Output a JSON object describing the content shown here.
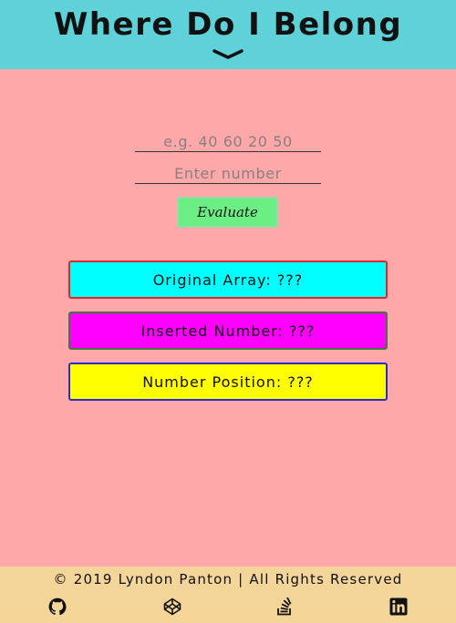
{
  "header": {
    "title": "Where Do I Belong",
    "toggle_icon": "chevron-down-icon"
  },
  "form": {
    "array_placeholder": "e.g. 40 60 20 50",
    "array_value": "",
    "number_placeholder": "Enter number",
    "number_value": "",
    "evaluate_label": "Evaluate",
    "evaluate_color": "#6bef84"
  },
  "results": {
    "original_array": "Original Array: ???",
    "inserted_number": "Inserted Number: ???",
    "number_position": "Number Position: ???"
  },
  "footer": {
    "copyright": "© 2019 Lyndon Panton | All Rights Reserved",
    "links": [
      {
        "icon": "github-icon"
      },
      {
        "icon": "codepen-icon"
      },
      {
        "icon": "stackoverflow-icon"
      },
      {
        "icon": "linkedin-icon"
      }
    ]
  },
  "colors": {
    "header_bg": "#5fd2d9",
    "page_bg": "#ffa8aa",
    "footer_bg": "#f3d59a",
    "original_bg": "#00ffff",
    "inserted_bg": "#ff00ff",
    "position_bg": "#ffff00"
  }
}
